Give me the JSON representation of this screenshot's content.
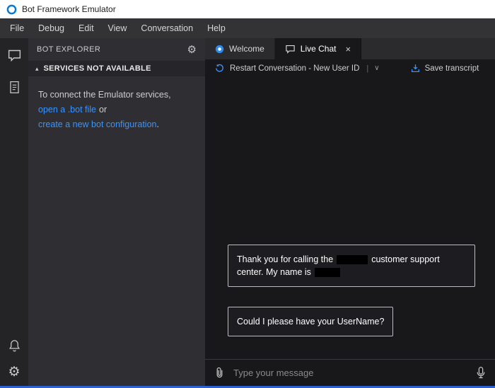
{
  "title_bar": {
    "title": "Bot Framework Emulator"
  },
  "menu": {
    "items": [
      "File",
      "Debug",
      "Edit",
      "View",
      "Conversation",
      "Help"
    ]
  },
  "sidebar": {
    "header": "BOT EXPLORER",
    "section_title": "SERVICES NOT AVAILABLE",
    "intro_line": "To connect the Emulator services,",
    "link_open_bot": "open a .bot file",
    "or_text": "or",
    "link_create_config": "create a new bot configuration",
    "period": "."
  },
  "tabs": {
    "welcome": "Welcome",
    "live_chat": "Live Chat"
  },
  "toolbar": {
    "restart_label": "Restart Conversation - New User ID",
    "save_label": "Save transcript"
  },
  "chat": {
    "message1": {
      "part1": "Thank you for calling the",
      "part2": "customer support center. My name is"
    },
    "message2": "Could I please have your UserName?"
  },
  "composer": {
    "placeholder": "Type your message"
  },
  "colors": {
    "accent_blue": "#3794ff",
    "link_blue": "#3794ff",
    "status_strip_blue": "#2e62d4"
  },
  "glyphs": {
    "gear": "⚙",
    "close": "×",
    "chevron_down": "∨",
    "separator": "|",
    "section_indicator": "▴"
  }
}
